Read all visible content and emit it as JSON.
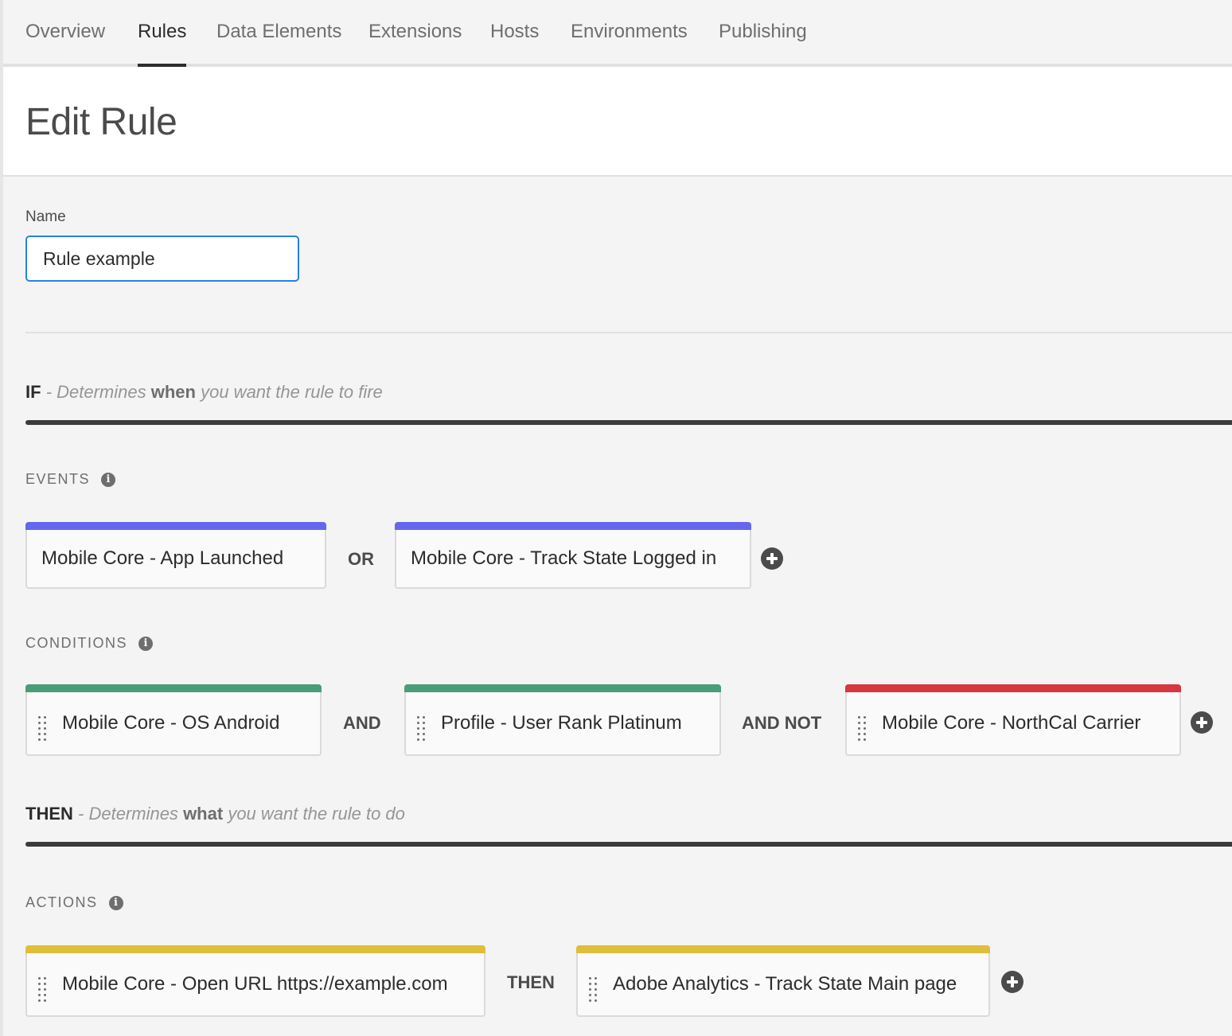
{
  "nav": {
    "tabs": [
      {
        "label": "Overview"
      },
      {
        "label": "Rules"
      },
      {
        "label": "Data Elements"
      },
      {
        "label": "Extensions"
      },
      {
        "label": "Hosts"
      },
      {
        "label": "Environments"
      },
      {
        "label": "Publishing"
      }
    ],
    "active": "Rules"
  },
  "page": {
    "title": "Edit Rule"
  },
  "name_field": {
    "label": "Name",
    "value": "Rule example"
  },
  "if_section": {
    "keyword": "IF",
    "pre": "- Determines",
    "strong": "when",
    "post": "you want the rule to fire"
  },
  "events": {
    "label": "EVENTS",
    "items": [
      {
        "text": "Mobile Core - App Launched"
      },
      {
        "text": "Mobile Core - Track State Logged in"
      }
    ],
    "operators": [
      "OR"
    ],
    "color": "#6767ec"
  },
  "conditions": {
    "label": "CONDITIONS",
    "items": [
      {
        "text": "Mobile Core - OS Android",
        "color": "#4b9c78"
      },
      {
        "text": "Profile - User Rank Platinum",
        "color": "#4b9c78"
      },
      {
        "text": "Mobile Core - NorthCal Carrier",
        "color": "#d7373f"
      }
    ],
    "operators": [
      "AND",
      "AND NOT"
    ]
  },
  "then_section": {
    "keyword": "THEN",
    "pre": "- Determines",
    "strong": "what",
    "post": "you want the rule to do"
  },
  "actions": {
    "label": "ACTIONS",
    "items": [
      {
        "text": "Mobile Core - Open URL https://example.com"
      },
      {
        "text": "Adobe Analytics - Track State Main page"
      }
    ],
    "operators": [
      "THEN"
    ],
    "color": "#dfbf00"
  },
  "icons": {
    "info": "info-icon",
    "add": "add-circle-icon",
    "grip": "drag-handle-icon"
  }
}
